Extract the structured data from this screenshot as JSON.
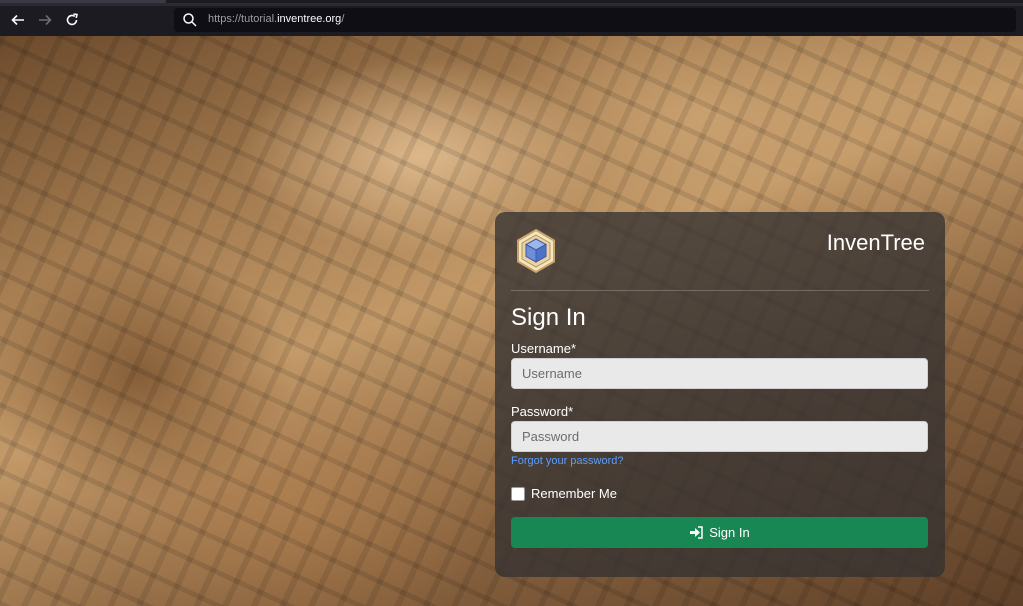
{
  "browser": {
    "url_prefix": "https://tutorial.",
    "url_domain": "inventree.org",
    "url_suffix": "/"
  },
  "login": {
    "brand": "InvenTree",
    "title": "Sign In",
    "username_label": "Username*",
    "username_placeholder": "Username",
    "password_label": "Password*",
    "password_placeholder": "Password",
    "forgot_link": "Forgot your password?",
    "remember_label": "Remember Me",
    "signin_label": "Sign In"
  },
  "colors": {
    "signin_button": "#198754",
    "link": "#5b9dff"
  }
}
